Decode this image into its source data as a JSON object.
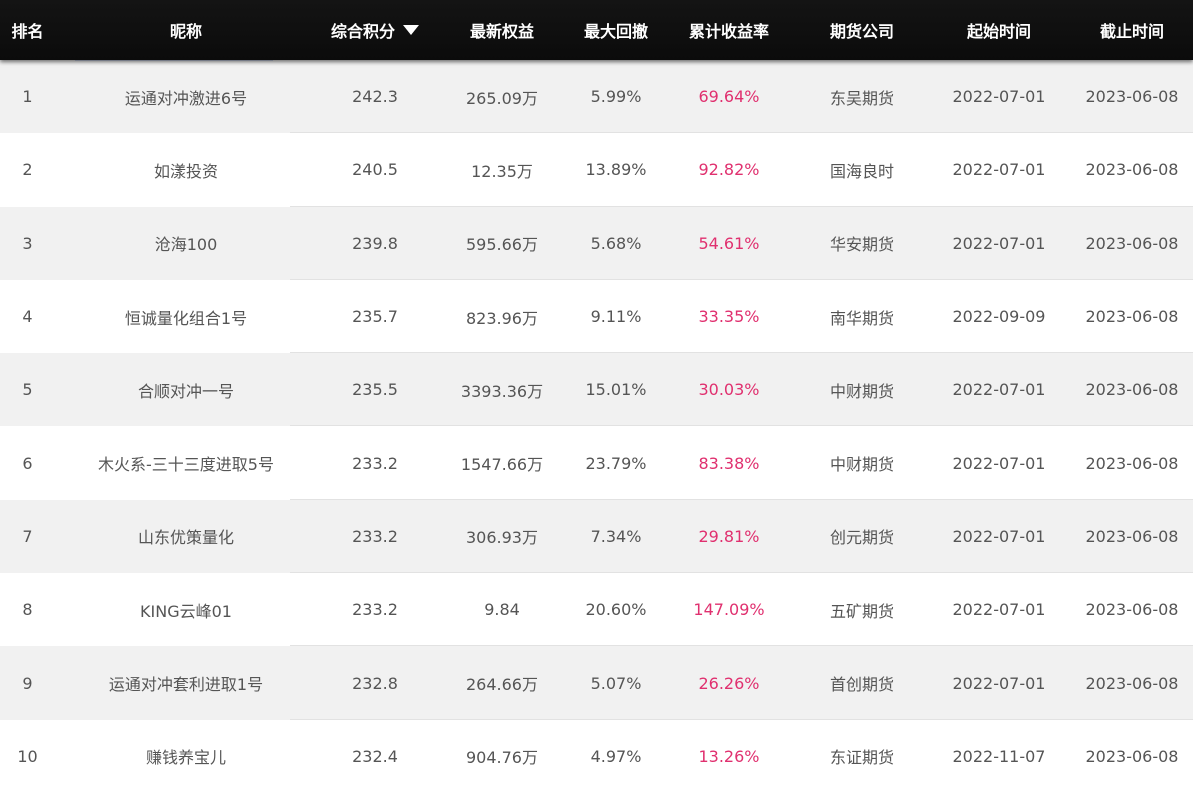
{
  "header": {
    "rank": "排名",
    "nickname": "昵称",
    "score": "综合积分",
    "equity": "最新权益",
    "max_drawdown": "最大回撤",
    "cum_return": "累计收益率",
    "company": "期货公司",
    "start": "起始时间",
    "end": "截止时间",
    "sort_icon": "caret-down-icon"
  },
  "colors": {
    "header_bg": "#0b0b0b",
    "header_text": "#ffffff",
    "row_alt_bg": "#f1f1f1",
    "return_text": "#e0306f",
    "body_text": "#555555"
  },
  "rows": [
    {
      "rank": "1",
      "name": "运通对冲激进6号",
      "score": "242.3",
      "equity": "265.09万",
      "drawdown": "5.99%",
      "rate": "69.64%",
      "company": "东吴期货",
      "start": "2022-07-01",
      "end": "2023-06-08"
    },
    {
      "rank": "2",
      "name": "如漾投资",
      "score": "240.5",
      "equity": "12.35万",
      "drawdown": "13.89%",
      "rate": "92.82%",
      "company": "国海良时",
      "start": "2022-07-01",
      "end": "2023-06-08"
    },
    {
      "rank": "3",
      "name": "沧海100",
      "score": "239.8",
      "equity": "595.66万",
      "drawdown": "5.68%",
      "rate": "54.61%",
      "company": "华安期货",
      "start": "2022-07-01",
      "end": "2023-06-08"
    },
    {
      "rank": "4",
      "name": "恒诚量化组合1号",
      "score": "235.7",
      "equity": "823.96万",
      "drawdown": "9.11%",
      "rate": "33.35%",
      "company": "南华期货",
      "start": "2022-09-09",
      "end": "2023-06-08"
    },
    {
      "rank": "5",
      "name": "合顺对冲一号",
      "score": "235.5",
      "equity": "3393.36万",
      "drawdown": "15.01%",
      "rate": "30.03%",
      "company": "中财期货",
      "start": "2022-07-01",
      "end": "2023-06-08"
    },
    {
      "rank": "6",
      "name": "木火系-三十三度进取5号",
      "score": "233.2",
      "equity": "1547.66万",
      "drawdown": "23.79%",
      "rate": "83.38%",
      "company": "中财期货",
      "start": "2022-07-01",
      "end": "2023-06-08"
    },
    {
      "rank": "7",
      "name": "山东优策量化",
      "score": "233.2",
      "equity": "306.93万",
      "drawdown": "7.34%",
      "rate": "29.81%",
      "company": "创元期货",
      "start": "2022-07-01",
      "end": "2023-06-08"
    },
    {
      "rank": "8",
      "name": "KING云峰01",
      "score": "233.2",
      "equity": "9.84",
      "drawdown": "20.60%",
      "rate": "147.09%",
      "company": "五矿期货",
      "start": "2022-07-01",
      "end": "2023-06-08"
    },
    {
      "rank": "9",
      "name": "运通对冲套利进取1号",
      "score": "232.8",
      "equity": "264.66万",
      "drawdown": "5.07%",
      "rate": "26.26%",
      "company": "首创期货",
      "start": "2022-07-01",
      "end": "2023-06-08"
    },
    {
      "rank": "10",
      "name": "赚钱养宝儿",
      "score": "232.4",
      "equity": "904.76万",
      "drawdown": "4.97%",
      "rate": "13.26%",
      "company": "东证期货",
      "start": "2022-11-07",
      "end": "2023-06-08"
    }
  ]
}
